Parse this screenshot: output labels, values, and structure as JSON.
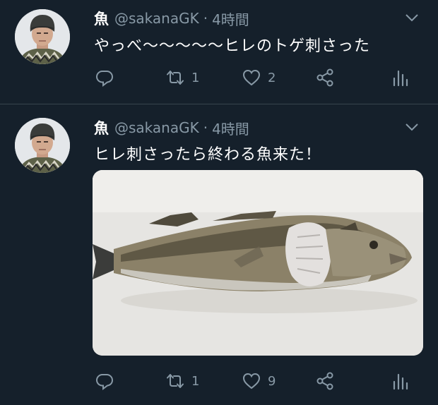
{
  "tweets": [
    {
      "name": "魚",
      "handle": "@sakanaGK",
      "separator": "·",
      "time": "4時間",
      "text": "やっべ〜〜〜〜〜ヒレのトゲ刺さった",
      "retweets": "1",
      "likes": "2",
      "has_image": false
    },
    {
      "name": "魚",
      "handle": "@sakanaGK",
      "separator": "·",
      "time": "4時間",
      "text": "ヒレ刺さったら終わる魚来た！",
      "retweets": "1",
      "likes": "9",
      "has_image": true
    }
  ],
  "icons": {
    "reply": "reply-icon",
    "retweet": "retweet-icon",
    "like": "like-icon",
    "share": "share-icon",
    "stats": "stats-icon",
    "menu": "chevron-down-icon"
  },
  "colors": {
    "background": "#15202b",
    "secondary_text": "#8899a6",
    "divider": "#38444d"
  }
}
